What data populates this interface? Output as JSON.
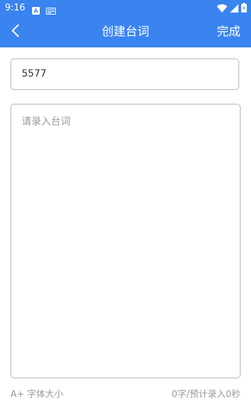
{
  "status_bar": {
    "time": "9:16"
  },
  "header": {
    "title": "创建台词",
    "done_label": "完成"
  },
  "form": {
    "name_value": "5577",
    "script_placeholder": "请录入台词"
  },
  "footer": {
    "font_size_label": "A+ 字体大小",
    "word_count": "0字/预计录入0秒"
  },
  "colors": {
    "accent": "#3a84f0"
  },
  "icons": {
    "back": "chevron-left-icon",
    "wifi": "wifi-icon",
    "signal": "signal-icon",
    "battery": "battery-icon"
  }
}
